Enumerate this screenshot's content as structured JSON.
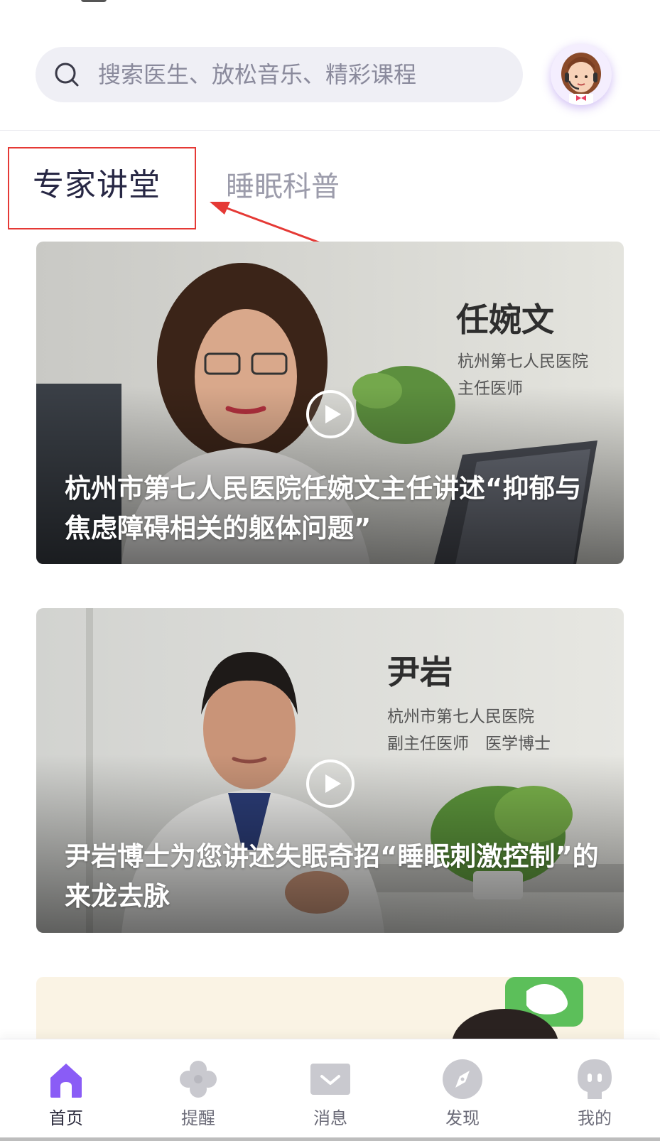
{
  "search": {
    "placeholder": "搜索医生、放松音乐、精彩课程"
  },
  "tabs": [
    {
      "label": "专家讲堂",
      "active": true
    },
    {
      "label": "睡眠科普",
      "active": false
    }
  ],
  "cards": [
    {
      "doctor_name": "任婉文",
      "hospital": "杭州第七人民医院",
      "position": "主任医师",
      "title": "杭州市第七人民医院任婉文主任讲述“抑郁与焦虑障碍相关的躯体问题”"
    },
    {
      "doctor_name": "尹岩",
      "hospital": "杭州市第七人民医院",
      "position": "副主任医师　医学博士",
      "title": "尹岩博士为您讲述失眠奇招“睡眠刺激控制”的来龙去脉"
    }
  ],
  "tabbar": [
    {
      "label": "首页",
      "icon": "home-icon",
      "active": true
    },
    {
      "label": "提醒",
      "icon": "clover-icon",
      "active": false
    },
    {
      "label": "消息",
      "icon": "message-icon",
      "active": false
    },
    {
      "label": "发现",
      "icon": "compass-icon",
      "active": false
    },
    {
      "label": "我的",
      "icon": "profile-icon",
      "active": false
    }
  ],
  "colors": {
    "accent": "#8a5cf6",
    "annotation": "#e53935",
    "inactive_icon": "#c9c9cf"
  }
}
